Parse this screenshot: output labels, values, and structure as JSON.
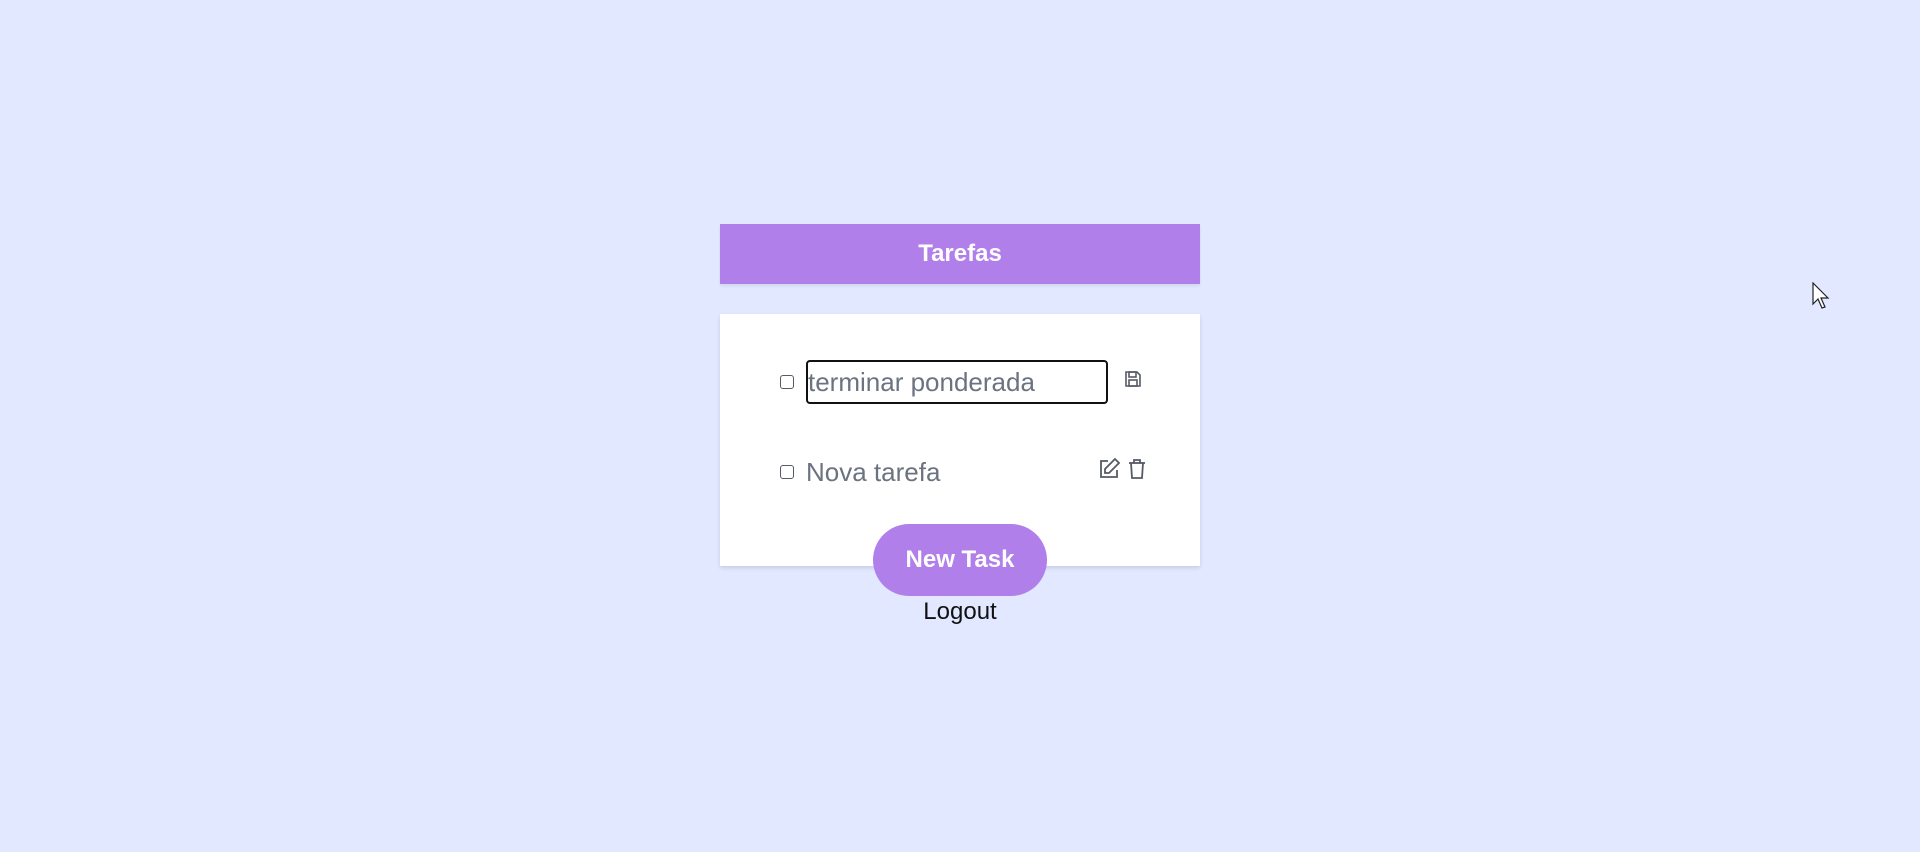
{
  "header": {
    "title": "Tarefas"
  },
  "tasks": [
    {
      "text": "terminar ponderada",
      "editing": true,
      "checked": false,
      "action_icons": [
        "save-icon"
      ]
    },
    {
      "text": "Nova tarefa",
      "editing": false,
      "checked": false,
      "action_icons": [
        "edit-icon",
        "trash-icon"
      ]
    }
  ],
  "actions": {
    "new_task_label": "New Task",
    "logout_label": "Logout"
  },
  "colors": {
    "background": "#e2e8ff",
    "accent": "#b07fe9",
    "text_muted": "#6b7280"
  }
}
